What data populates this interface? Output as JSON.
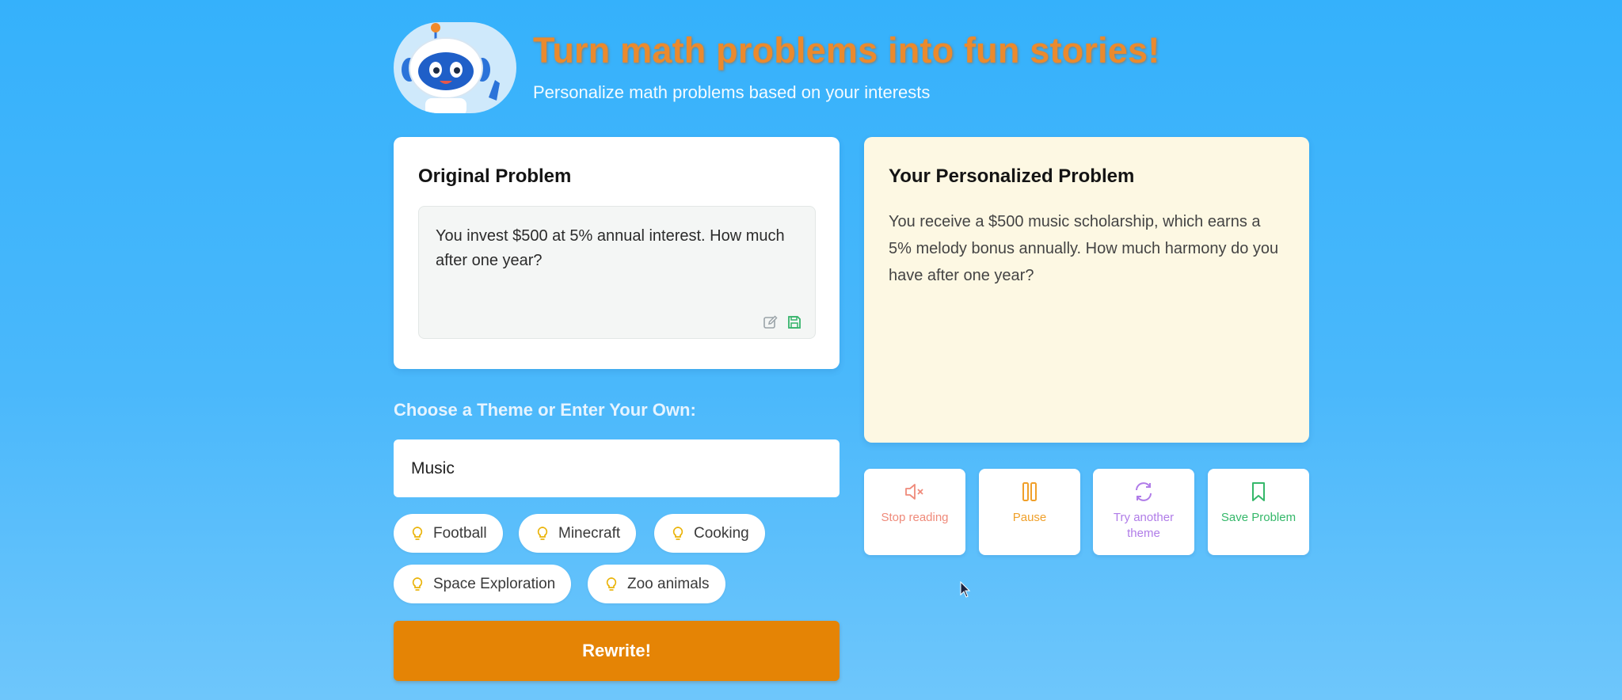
{
  "header": {
    "title": "Turn math problems into fun stories!",
    "subtitle": "Personalize math problems based on your interests",
    "mascot_icon": "robot-mascot"
  },
  "original": {
    "title": "Original Problem",
    "text": "You invest $500 at 5% annual interest. How much after one year?",
    "edit_icon": "edit-icon",
    "save_icon": "save-icon"
  },
  "personalized": {
    "title": "Your Personalized Problem",
    "text": "You receive a $500 music scholarship, which earns a 5% melody bonus annually. How much harmony do you have after one year?"
  },
  "theme": {
    "label": "Choose a Theme or Enter Your Own:",
    "value": "Music",
    "chips": [
      "Football",
      "Minecraft",
      "Cooking",
      "Space Exploration",
      "Zoo animals"
    ]
  },
  "rewrite_label": "Rewrite!",
  "actions": [
    {
      "label": "Stop reading",
      "icon": "speaker-muted-icon",
      "color": "#ef8a7a"
    },
    {
      "label": "Pause",
      "icon": "pause-icon",
      "color": "#f0a02a"
    },
    {
      "label": "Try another theme",
      "icon": "refresh-icon",
      "color": "#b07ce8"
    },
    {
      "label": "Save Problem",
      "icon": "bookmark-icon",
      "color": "#35b86a"
    }
  ],
  "colors": {
    "background": "#35b1fb",
    "title": "#ea8a2e",
    "rewrite": "#e58405",
    "personalized_bg": "#fdf8e3"
  }
}
